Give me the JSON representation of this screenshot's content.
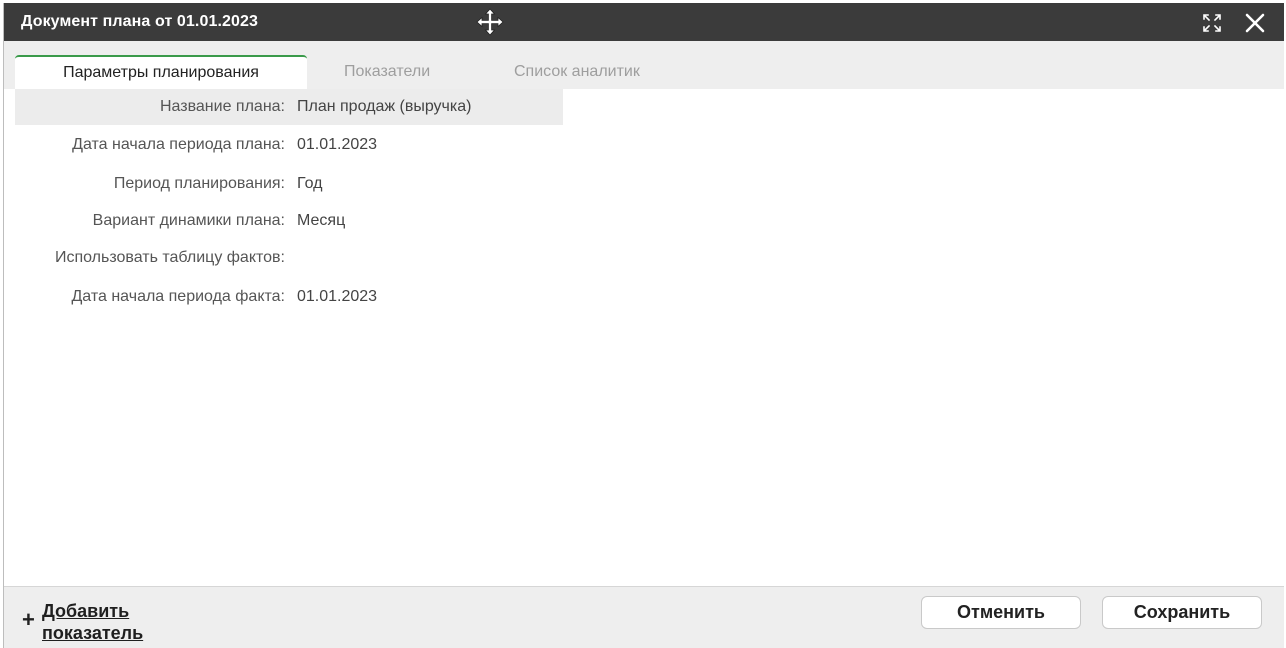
{
  "window": {
    "title": "Документ плана от 01.01.2023"
  },
  "tabs": [
    {
      "label": "Параметры планирования",
      "active": true
    },
    {
      "label": "Показатели",
      "active": false
    },
    {
      "label": "Список аналитик",
      "active": false
    }
  ],
  "form": {
    "rows": [
      {
        "label": "Название плана:",
        "value": "План продаж (выручка)"
      },
      {
        "label": "Дата начала периода плана:",
        "value": "01.01.2023"
      },
      {
        "label": "Период планирования:",
        "value": "Год"
      },
      {
        "label": "Вариант динамики плана:",
        "value": "Месяц"
      },
      {
        "label": "Использовать таблицу фактов:",
        "value": ""
      },
      {
        "label": "Дата начала периода факта:",
        "value": "01.01.2023"
      }
    ]
  },
  "footer": {
    "add_plus": "+",
    "add_label": "Добавить показатель",
    "cancel_label": "Отменить",
    "save_label": "Сохранить"
  },
  "icons": {
    "move": "move-icon",
    "expand": "expand-icon",
    "close": "close-icon"
  },
  "colors": {
    "titlebar": "#3b3b3b",
    "tab_accent": "#3a9a4a",
    "panel_bg": "#eeeeee"
  }
}
